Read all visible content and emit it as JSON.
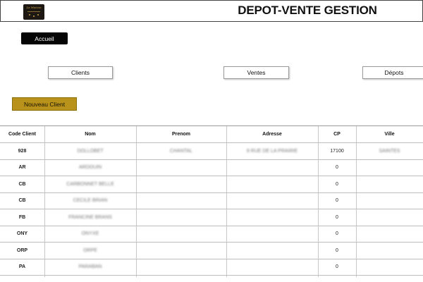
{
  "header": {
    "logo_text": "La Maison",
    "title": "DEPOT-VENTE GESTION"
  },
  "buttons": {
    "accueil": "Accueil",
    "clients": "Clients",
    "ventes": "Ventes",
    "depots": "Dépots",
    "nouveau_client": "Nouveau Client"
  },
  "table": {
    "columns": [
      "Code Client",
      "Nom",
      "Prenom",
      "Adresse",
      "CP",
      "Ville"
    ],
    "rows": [
      {
        "code": "928",
        "nom": "DOLLOBET",
        "prenom": "CHANTAL",
        "adresse": "8 RUE DE LA PRAIRIE",
        "cp": "17100",
        "ville": "SAINTES"
      },
      {
        "code": "AR",
        "nom": "ARDOUIN",
        "prenom": "",
        "adresse": "",
        "cp": "0",
        "ville": ""
      },
      {
        "code": "CB",
        "nom": "CARBONNET BELLE",
        "prenom": "",
        "adresse": "",
        "cp": "0",
        "ville": ""
      },
      {
        "code": "CB",
        "nom": "CECILE BRIAN",
        "prenom": "",
        "adresse": "",
        "cp": "0",
        "ville": ""
      },
      {
        "code": "FB",
        "nom": "FRANCINE BRANS",
        "prenom": "",
        "adresse": "",
        "cp": "0",
        "ville": ""
      },
      {
        "code": "ONY",
        "nom": "ONYXE",
        "prenom": "",
        "adresse": "",
        "cp": "0",
        "ville": ""
      },
      {
        "code": "ORP",
        "nom": "ORPE",
        "prenom": "",
        "adresse": "",
        "cp": "0",
        "ville": ""
      },
      {
        "code": "PA",
        "nom": "PARABAN",
        "prenom": "",
        "adresse": "",
        "cp": "0",
        "ville": ""
      }
    ]
  },
  "colors": {
    "accueil_bg": "#050505",
    "nouveau_client_bg": "#b8921a",
    "logo_bg": "#1e1812",
    "logo_accent": "#c9a24a"
  }
}
